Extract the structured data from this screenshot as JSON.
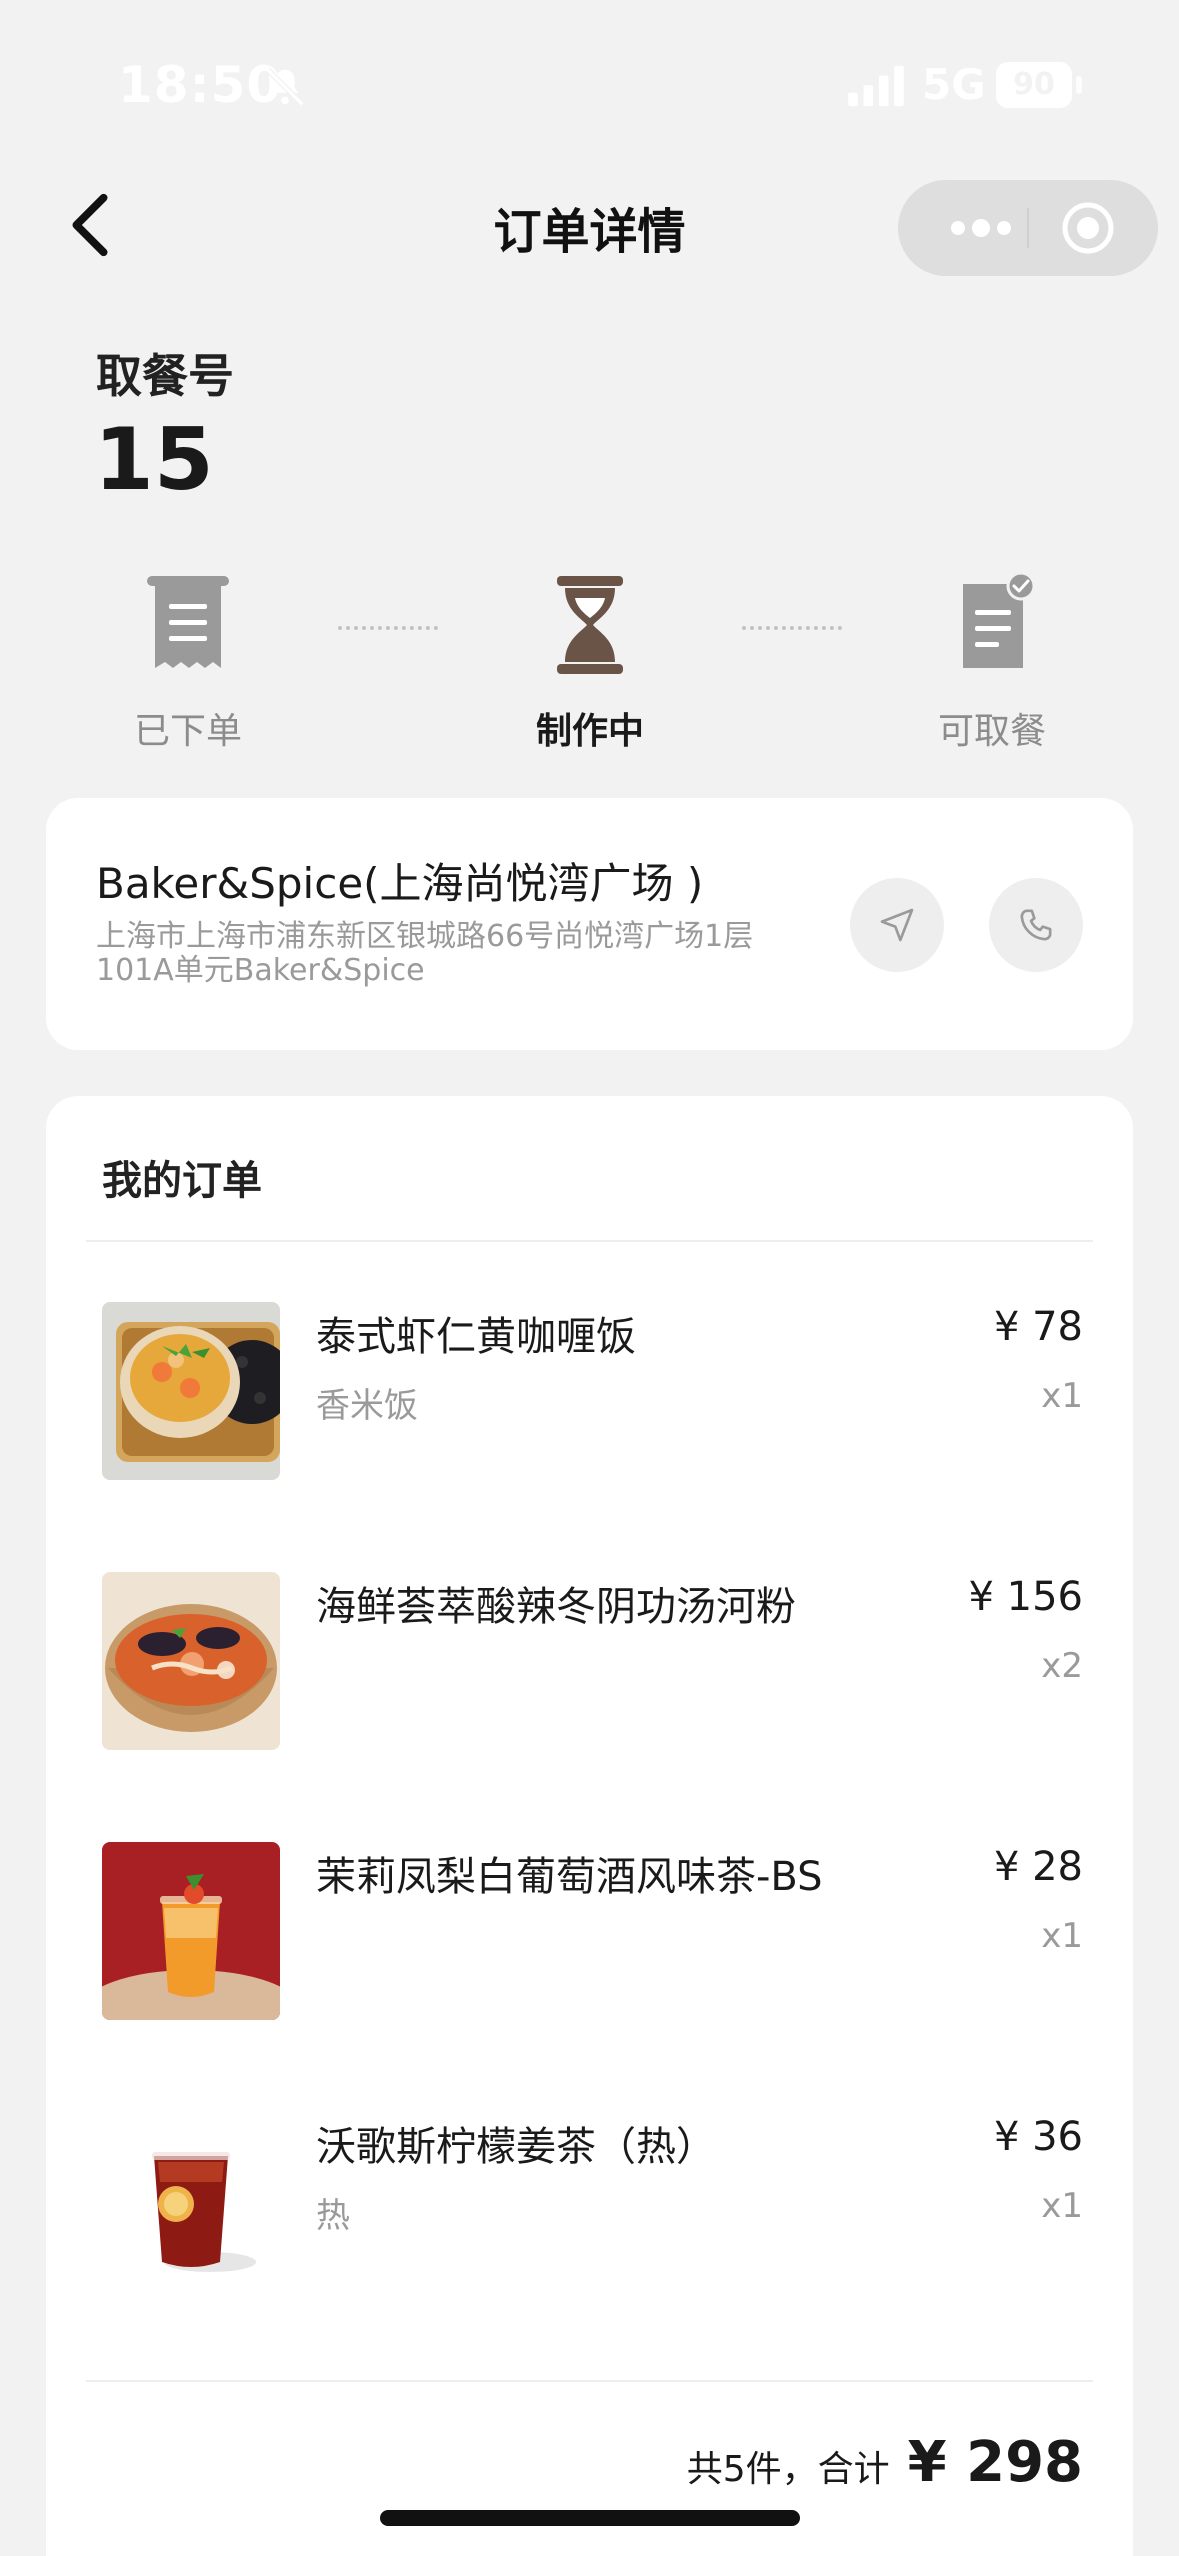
{
  "status_bar": {
    "time": "18:50",
    "network": "5G",
    "battery": "90"
  },
  "nav": {
    "title": "订单详情"
  },
  "pickup": {
    "label": "取餐号",
    "number": "15"
  },
  "progress": {
    "steps": [
      {
        "label": "已下单"
      },
      {
        "label": "制作中"
      },
      {
        "label": "可取餐"
      }
    ]
  },
  "store": {
    "name": "Baker&Spice(上海尚悦湾广场 )",
    "address": "上海市上海市浦东新区银城路66号尚悦湾广场1层101A单元Baker&Spice"
  },
  "order": {
    "title": "我的订单",
    "items": [
      {
        "name": "泰式虾仁黄咖喱饭",
        "sub": "香米饭",
        "price": "¥ 78",
        "qty": "x1"
      },
      {
        "name": "海鲜荟萃酸辣冬阴功汤河粉",
        "sub": "",
        "price": "¥ 156",
        "qty": "x2"
      },
      {
        "name": "茉莉凤梨白葡萄酒风味茶-BS",
        "sub": "",
        "price": "¥ 28",
        "qty": "x1"
      },
      {
        "name": "沃歌斯柠檬姜茶（热）",
        "sub": "热",
        "price": "¥ 36",
        "qty": "x1"
      }
    ],
    "summary": "共5件，合计",
    "total": "¥ 298"
  }
}
